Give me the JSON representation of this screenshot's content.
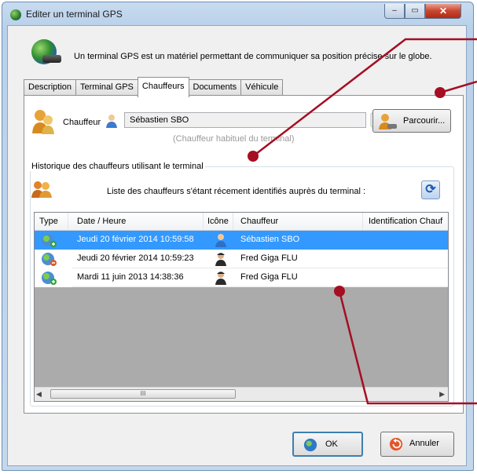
{
  "window": {
    "title": "Editer un terminal GPS",
    "controls": {
      "minimize": "–",
      "maximize": "▭",
      "close": "✕"
    }
  },
  "header": {
    "description": "Un terminal GPS est un matériel permettant de communiquer sa position précise sur le globe."
  },
  "tabs": [
    {
      "label": "Description",
      "active": false
    },
    {
      "label": "Terminal GPS",
      "active": false
    },
    {
      "label": "Chauffeurs",
      "active": true
    },
    {
      "label": "Documents",
      "active": false
    },
    {
      "label": "Véhicule",
      "active": false
    }
  ],
  "driver": {
    "label": "Chauffeur",
    "value": "Sébastien SBO",
    "hint": "(Chauffeur habituel du terminal)",
    "browse_label": "Parcourir..."
  },
  "history": {
    "group_title": "Historique des chauffeurs utilisant le terminal",
    "description": "Liste des chauffeurs s'étant récement identifiés auprès du terminal :",
    "columns": [
      "Type",
      "Date / Heure",
      "Icône",
      "Chauffeur",
      "Identification Chauf"
    ],
    "rows": [
      {
        "date": "Jeudi 20 février 2014 10:59:58",
        "driver": "Sébastien SBO",
        "selected": true,
        "icon": "user-blue-icon"
      },
      {
        "date": "Jeudi 20 février 2014 10:59:23",
        "driver": "Fred Giga FLU",
        "selected": false,
        "icon": "user-dark-icon"
      },
      {
        "date": "Mardi 11 juin 2013 14:38:36",
        "driver": "Fred Giga FLU",
        "selected": false,
        "icon": "user-dark-icon"
      }
    ],
    "scroll_thumb": "III"
  },
  "buttons": {
    "ok": "OK",
    "cancel": "Annuler"
  },
  "colors": {
    "annotation": "#a50e23",
    "selection": "#3399ff"
  }
}
